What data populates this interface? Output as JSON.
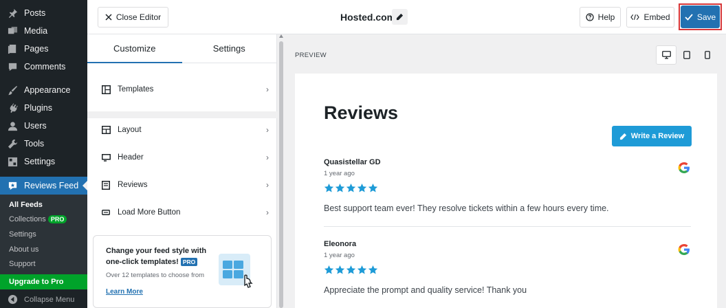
{
  "wp_menu": {
    "items": [
      {
        "label": "Posts",
        "icon": "pin-icon"
      },
      {
        "label": "Media",
        "icon": "media-icon"
      },
      {
        "label": "Pages",
        "icon": "pages-icon"
      },
      {
        "label": "Comments",
        "icon": "comment-icon"
      },
      {
        "label": "Appearance",
        "icon": "brush-icon"
      },
      {
        "label": "Plugins",
        "icon": "plugin-icon"
      },
      {
        "label": "Users",
        "icon": "user-icon"
      },
      {
        "label": "Tools",
        "icon": "wrench-icon"
      },
      {
        "label": "Settings",
        "icon": "settings-icon"
      }
    ],
    "active": {
      "label": "Reviews Feed",
      "icon": "reviews-feed-icon"
    },
    "submenu": [
      {
        "label": "All Feeds",
        "current": true
      },
      {
        "label": "Collections",
        "badge": "PRO"
      },
      {
        "label": "Settings"
      },
      {
        "label": "About us"
      },
      {
        "label": "Support"
      }
    ],
    "upgrade": "Upgrade to Pro",
    "collapse": "Collapse Menu"
  },
  "topbar": {
    "close_label": "Close Editor",
    "feed_title": "Hosted.com",
    "help_label": "Help",
    "embed_label": "Embed",
    "save_label": "Save"
  },
  "customizer": {
    "tabs": [
      "Customize",
      "Settings"
    ],
    "active_tab": "Customize",
    "menu": [
      {
        "label": "Templates",
        "icon": "templates-icon"
      },
      {
        "label": "Layout",
        "icon": "layout-icon"
      },
      {
        "label": "Header",
        "icon": "header-icon"
      },
      {
        "label": "Reviews",
        "icon": "reviews-icon"
      },
      {
        "label": "Load More Button",
        "icon": "load-more-icon"
      }
    ],
    "promo": {
      "title": "Change your feed style with one-click templates!",
      "badge": "PRO",
      "desc": "Over 12 templates to choose from",
      "link": "Learn More"
    }
  },
  "preview": {
    "label": "PREVIEW",
    "devices": [
      "desktop-icon",
      "tablet-icon",
      "mobile-icon"
    ],
    "active_device": "desktop-icon",
    "title": "Reviews",
    "write_review_label": "Write a Review",
    "reviews": [
      {
        "name": "Quasistellar GD",
        "time": "1 year ago",
        "rating": 5,
        "text": "Best support team ever! They resolve tickets within a few hours every time.",
        "source": "google-icon"
      },
      {
        "name": "Eleonora",
        "time": "1 year ago",
        "rating": 5,
        "text": "Appreciate the prompt and quality service! Thank you",
        "source": "google-icon"
      }
    ]
  },
  "colors": {
    "wp_sidebar": "#1d2327",
    "wp_accent": "#2271b1",
    "pro_green": "#00a32a",
    "star_blue": "#1e9bd7",
    "save_highlight": "#d63638"
  }
}
